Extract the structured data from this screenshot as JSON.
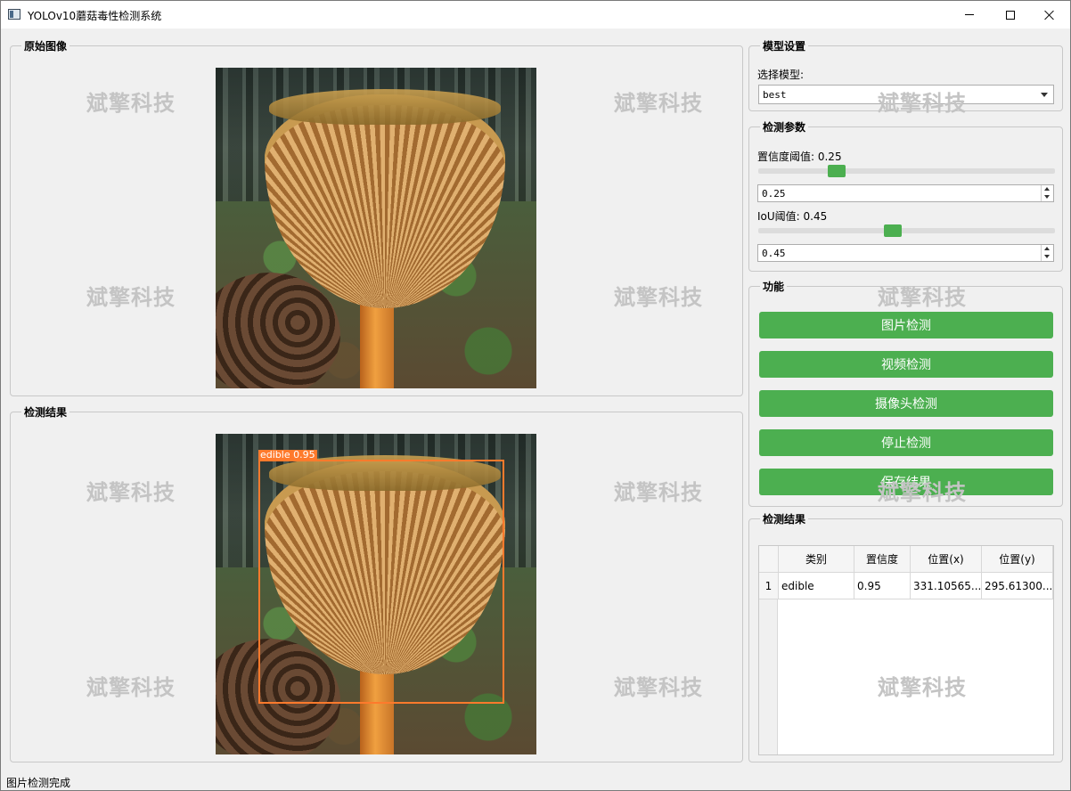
{
  "window": {
    "title": "YOLOv10蘑菇毒性检测系统"
  },
  "watermark": "斌擎科技",
  "left": {
    "original_group_title": "原始图像",
    "result_group_title": "检测结果",
    "detection_label": "edible  0.95"
  },
  "model_settings": {
    "group_title": "模型设置",
    "select_label": "选择模型:",
    "selected_model": "best"
  },
  "detection_params": {
    "group_title": "检测参数",
    "confidence_label": "置信度阈值: 0.25",
    "confidence_value": "0.25",
    "confidence_level": 0.25,
    "iou_label": "IoU阈值: 0.45",
    "iou_value": "0.45",
    "iou_level": 0.45
  },
  "functions": {
    "group_title": "功能",
    "buttons": [
      "图片检测",
      "视频检测",
      "摄像头检测",
      "停止检测",
      "保存结果"
    ]
  },
  "results": {
    "group_title": "检测结果",
    "columns": [
      "类别",
      "置信度",
      "位置(x)",
      "位置(y)"
    ],
    "rows": [
      {
        "index": "1",
        "class": "edible",
        "confidence": "0.95",
        "x": "331.10565...",
        "y": "295.61300..."
      }
    ]
  },
  "status": {
    "text": "图片检测完成"
  }
}
